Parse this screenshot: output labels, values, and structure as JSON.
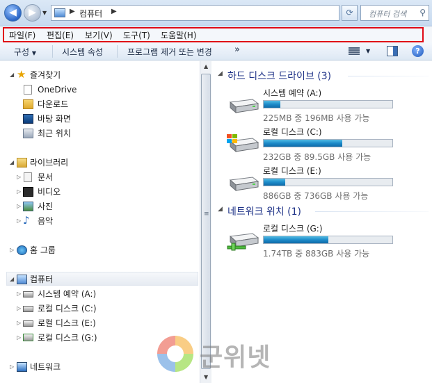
{
  "address": {
    "crumb": "컴퓨터",
    "search_placeholder": "컴퓨터 검색"
  },
  "menu": [
    "파일(F)",
    "편집(E)",
    "보기(V)",
    "도구(T)",
    "도움말(H)"
  ],
  "toolbar": {
    "organize": "구성",
    "system_properties": "시스템 속성",
    "uninstall": "프로그램 제거 또는 변경",
    "more": "»"
  },
  "nav": {
    "favorites": {
      "label": "즐겨찾기",
      "items": [
        "OneDrive",
        "다운로드",
        "바탕 화면",
        "최근 위치"
      ]
    },
    "libraries": {
      "label": "라이브러리",
      "items": [
        "문서",
        "비디오",
        "사진",
        "음악"
      ]
    },
    "homegroup": "홈 그룹",
    "computer": {
      "label": "컴퓨터",
      "items": [
        "시스템 예약 (A:)",
        "로컬 디스크 (C:)",
        "로컬 디스크 (E:)",
        "로컬 디스크 (G:)"
      ]
    },
    "network": "네트워크"
  },
  "content": {
    "hdd_group": "하드 디스크 드라이브 (3)",
    "net_group": "네트워크 위치 (1)",
    "drives": [
      {
        "name": "시스템 예약 (A:)",
        "size": "225MB 중 196MB 사용 가능",
        "used_fraction": 0.13
      },
      {
        "name": "로컬 디스크 (C:)",
        "size": "232GB 중 89.5GB 사용 가능",
        "used_fraction": 0.61
      },
      {
        "name": "로컬 디스크 (E:)",
        "size": "886GB 중 736GB 사용 가능",
        "used_fraction": 0.17
      }
    ],
    "net_drives": [
      {
        "name": "로컬 디스크 (G:)",
        "size": "1.74TB 중 883GB 사용 가능",
        "used_fraction": 0.5
      }
    ]
  },
  "watermark": "군위넷",
  "colors": {
    "highlight_box": "#e00a16",
    "group_title": "#1e3287",
    "bar_fill": "#1d8bc9"
  }
}
